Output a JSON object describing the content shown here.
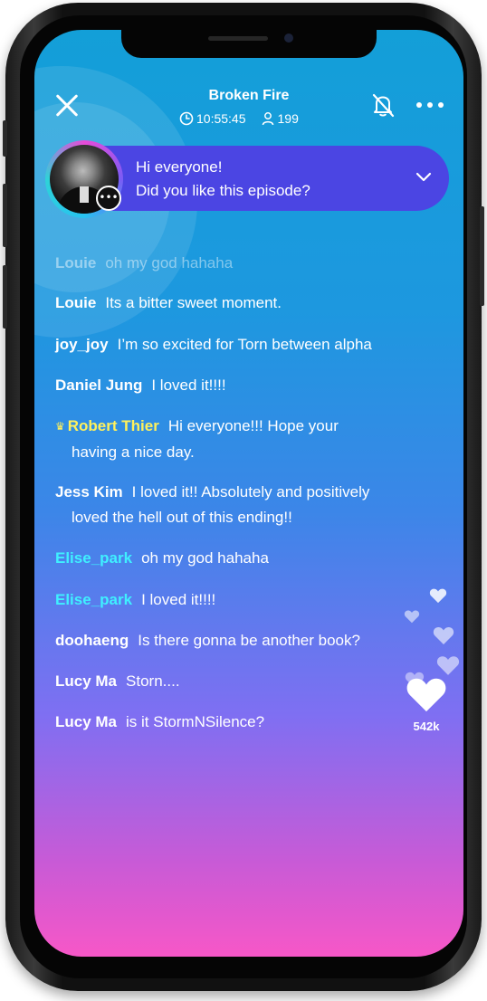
{
  "header": {
    "title": "Broken Fire",
    "time": "10:55:45",
    "viewers": "199"
  },
  "pinned": {
    "line1": "Hi everyone!",
    "line2": "Did you like this episode?"
  },
  "messages": [
    {
      "name": "Louie",
      "text": "oh my god hahaha"
    },
    {
      "name": "Louie",
      "text": "Its a bitter sweet moment."
    },
    {
      "name": "joy_joy",
      "text": "I’m so excited for Torn between alpha"
    },
    {
      "name": "Daniel Jung",
      "text": "I loved it!!!!"
    },
    {
      "name": "Robert Thier",
      "text": "Hi everyone!!! Hope your",
      "cont": "having a nice day."
    },
    {
      "name": "Jess Kim",
      "text": "I loved it!! Absolutely  and positively",
      "cont": "loved the hell out of this ending!!"
    },
    {
      "name": "Elise_park",
      "text": "oh my god hahaha"
    },
    {
      "name": "Elise_park",
      "text": "I loved it!!!!"
    },
    {
      "name": "doohaeng",
      "text": "Is there gonna be another book?"
    },
    {
      "name": "Lucy Ma",
      "text": "Storn...."
    },
    {
      "name": "Lucy Ma",
      "text": "is it StormNSilence?"
    }
  ],
  "likes": "542k",
  "icons": {
    "close": "close-icon",
    "clock": "clock-icon",
    "viewer": "user-icon",
    "bell_off": "bell-off-icon",
    "more": "more-icon",
    "chat": "chat-bubble-icon",
    "chevron": "chevron-down-icon",
    "heart": "heart-icon",
    "crown": "crown-icon"
  },
  "colors": {
    "gradient_top": "#139fd8",
    "gradient_bottom": "#f757c7",
    "pinned_bg": "#4b45e3",
    "highlight_name": "#3ff0ff",
    "vip_name": "#fff15c"
  }
}
